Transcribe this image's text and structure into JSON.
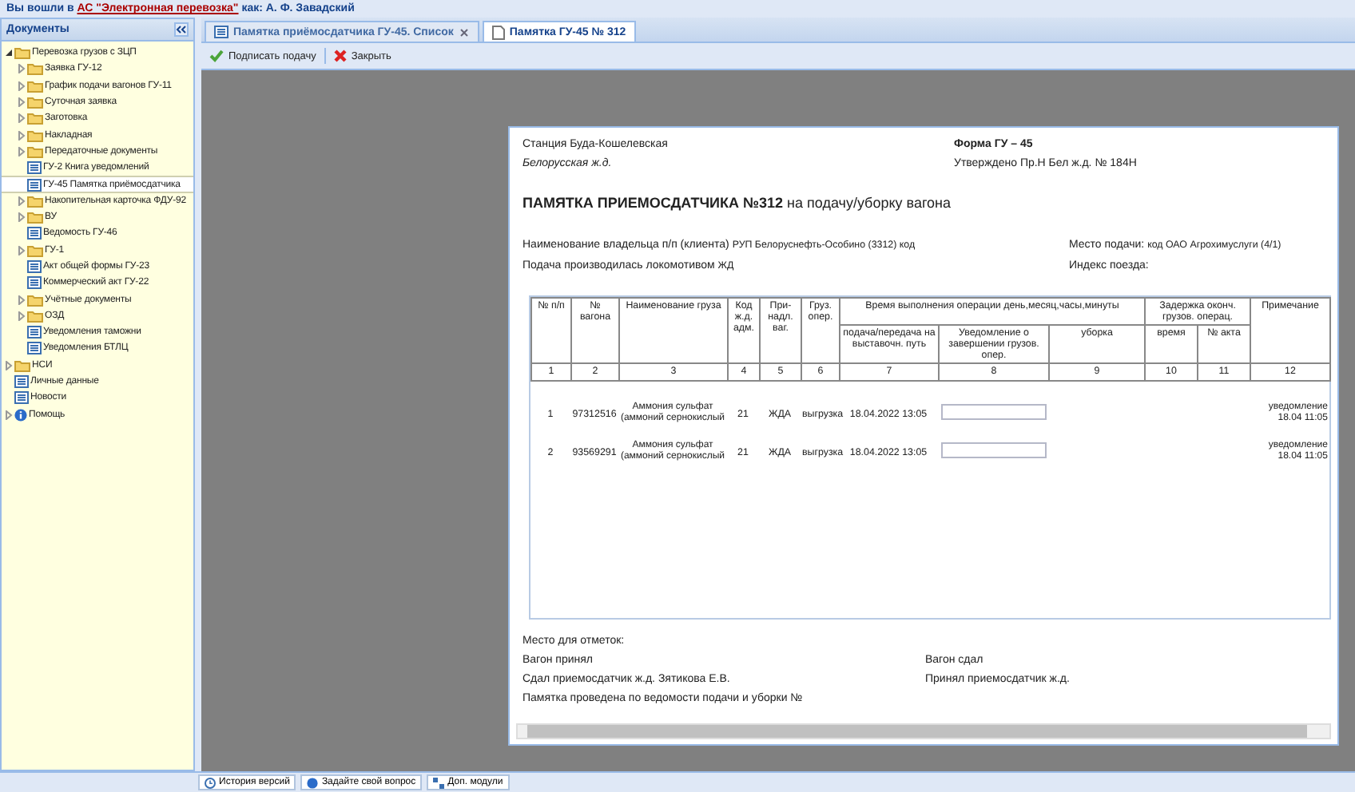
{
  "header": {
    "login_prefix": "Вы вошли в",
    "system_link": "АС \"Электронная перевозка\"",
    "login_suffix": "как: А. Ф. Завадский"
  },
  "sidebar": {
    "title": "Документы",
    "tree": [
      {
        "label": "Перевозка грузов с ЗЦП",
        "kind": "folder",
        "expanded": true,
        "selected": false,
        "children": [
          {
            "label": "Заявка ГУ-12",
            "kind": "folder",
            "expanded": false,
            "selected": false
          },
          {
            "label": "График подачи вагонов ГУ-11",
            "kind": "folder",
            "expanded": false,
            "selected": false
          },
          {
            "label": "Суточная заявка",
            "kind": "folder",
            "expanded": false,
            "selected": false
          },
          {
            "label": "Заготовка",
            "kind": "folder",
            "expanded": false,
            "selected": false
          },
          {
            "label": "Накладная",
            "kind": "folder",
            "expanded": false,
            "selected": false
          },
          {
            "label": "Передаточные документы",
            "kind": "folder",
            "expanded": false,
            "selected": false
          },
          {
            "label": "ГУ-2 Книга уведомлений",
            "kind": "doc",
            "selected": false
          },
          {
            "label": "ГУ-45 Памятка приёмосдатчика",
            "kind": "doc",
            "selected": true
          },
          {
            "label": "Накопительная карточка ФДУ-92",
            "kind": "folder",
            "expanded": false,
            "selected": false
          },
          {
            "label": "ВУ",
            "kind": "folder",
            "expanded": false,
            "selected": false
          },
          {
            "label": "Ведомость ГУ-46",
            "kind": "doc",
            "selected": false
          },
          {
            "label": "ГУ-1",
            "kind": "folder",
            "expanded": false,
            "selected": false
          },
          {
            "label": "Акт общей формы ГУ-23",
            "kind": "doc",
            "selected": false
          },
          {
            "label": "Коммерческий акт ГУ-22",
            "kind": "doc",
            "selected": false
          },
          {
            "label": "Учётные документы",
            "kind": "folder",
            "expanded": false,
            "selected": false
          },
          {
            "label": "ОЗД",
            "kind": "folder",
            "expanded": false,
            "selected": false
          },
          {
            "label": "Уведомления таможни",
            "kind": "doc",
            "selected": false
          },
          {
            "label": "Уведомления БТЛЦ",
            "kind": "doc",
            "selected": false
          }
        ]
      },
      {
        "label": "НСИ",
        "kind": "folder",
        "expanded": false,
        "selected": false
      },
      {
        "label": "Личные данные",
        "kind": "doc",
        "selected": false
      },
      {
        "label": "Новости",
        "kind": "doc",
        "selected": false
      },
      {
        "label": "Помощь",
        "kind": "info",
        "expanded": false,
        "selected": false
      }
    ]
  },
  "tabs": [
    {
      "label": "Памятка приёмосдатчика ГУ-45. Список",
      "selected": false,
      "closable": true
    },
    {
      "label": "Памятка ГУ-45 № 312",
      "selected": true,
      "closable": false
    }
  ],
  "toolbar": [
    {
      "label": "Подписать подачу",
      "kind": "sign"
    },
    {
      "label": "Закрыть",
      "kind": "close"
    }
  ],
  "document": {
    "station": "Станция Буда-Кошелевская",
    "road": "Белорусская ж.д.",
    "form": "Форма ГУ – 45",
    "approved": "Утверждено Пр.Н Бел ж.д. № 184Н",
    "title": "**ПАМЯТКА ПРИЕМОСДАТЧИКА №312** на подачу/уборку вагона",
    "owner_label": "Наименование владельца п/п (клиента)",
    "owner_value": "РУП Белоруснефть-Особино (3312) код",
    "place_label": "Место подачи:",
    "place_value": "код ОАО Агрохимуслуги (4/1)",
    "loco_label": "Подача производилась локомотивом",
    "loco_value": "ЖД",
    "train_label": "Индекс поезда:",
    "table": {
      "columns": [
        {
          "label": "№ п/п"
        },
        {
          "label": "№ вагона"
        },
        {
          "label": "Наименование груза"
        },
        {
          "label": "Код ж.д. адм."
        },
        {
          "label": "При-надл. ваг."
        },
        {
          "label": "Груз. опер."
        },
        {
          "label": "Время выполнения операции день,месяц,часы,минуты",
          "subcolumns": [
            {
              "label": "подача/передача на выставочн. путь"
            },
            {
              "label": "Уведомление о завершении грузов. опер."
            },
            {
              "label": "уборка"
            }
          ]
        },
        {
          "label": "Задержка оконч. грузов. операц.",
          "subcolumns": [
            {
              "label": "время"
            },
            {
              "label": "№ акта"
            }
          ]
        },
        {
          "label": "Примечание"
        }
      ],
      "numbers": [
        "1",
        "2",
        "3",
        "4",
        "5",
        "6",
        "7",
        "8",
        "9",
        "10",
        "11",
        "12"
      ],
      "rows": [
        {
          "no": "1",
          "wagon": "97312516",
          "cargo": "Аммония сульфат (аммоний сернокислый",
          "code": "21",
          "owner": "ЖДА",
          "operation": "выгрузка",
          "delivery_time": "18.04.2022 13:05",
          "note": "уведомление 18.04 11:05"
        },
        {
          "no": "2",
          "wagon": "93569291",
          "cargo": "Аммония сульфат (аммоний сернокислый",
          "code": "21",
          "owner": "ЖДА",
          "operation": "выгрузка",
          "delivery_time": "18.04.2022 13:05",
          "note": "уведомление 18.04 11:05"
        }
      ]
    },
    "marks_label": "Место для отметок:",
    "signatures": [
      {
        "left": "Вагон принял",
        "right": "Вагон сдал"
      },
      {
        "left": "Сдал приемосдатчик ж.д.  Зятикова Е.В.",
        "right": "Принял приемосдатчик ж.д."
      },
      {
        "left": "Памятка проведена по ведомости подачи и уборки №"
      }
    ]
  },
  "footer_buttons": [
    {
      "label": "История версий",
      "kind": "history"
    },
    {
      "label": "Задайте свой вопрос",
      "kind": "question"
    },
    {
      "label": "Доп. модули",
      "kind": "modules"
    }
  ]
}
